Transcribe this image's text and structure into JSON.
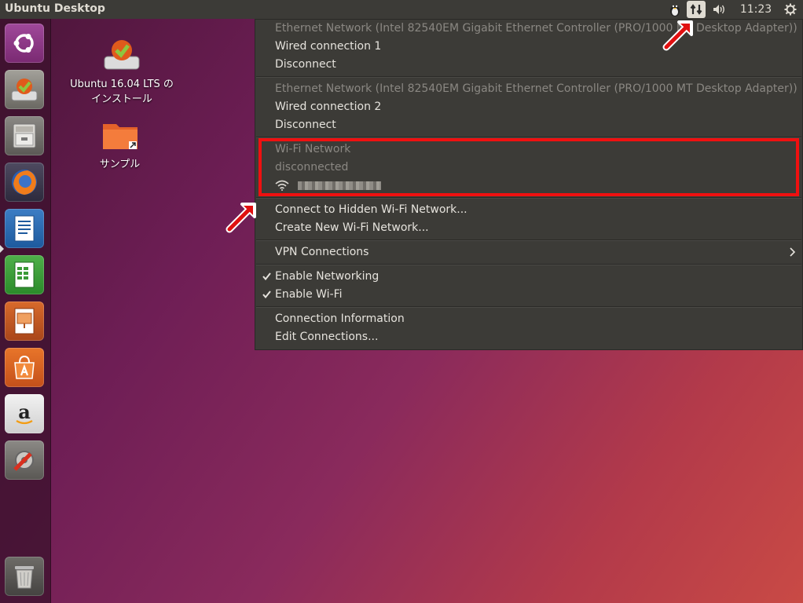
{
  "topbar": {
    "title": "Ubuntu Desktop",
    "clock": "11:23"
  },
  "launcher": {
    "items": [
      {
        "name": "ubuntu-dash-icon"
      },
      {
        "name": "ubuntu-installer-icon"
      },
      {
        "name": "files-icon"
      },
      {
        "name": "firefox-icon"
      },
      {
        "name": "libreoffice-writer-icon"
      },
      {
        "name": "libreoffice-calc-icon"
      },
      {
        "name": "libreoffice-impress-icon"
      },
      {
        "name": "software-center-icon"
      },
      {
        "name": "amazon-icon"
      },
      {
        "name": "system-settings-icon"
      },
      {
        "name": "trash-icon"
      }
    ]
  },
  "desktop": {
    "installer_label_line1": "Ubuntu 16.04 LTS の",
    "installer_label_line2": "インストール",
    "folder_label": "サンプル"
  },
  "menu": {
    "eth1_header": "Ethernet Network (Intel 82540EM Gigabit Ethernet Controller (PRO/1000 MT Desktop Adapter))",
    "eth1_conn": "Wired connection 1",
    "eth1_disconnect": "Disconnect",
    "eth2_header": "Ethernet Network (Intel 82540EM Gigabit Ethernet Controller (PRO/1000 MT Desktop Adapter))",
    "eth2_conn": "Wired connection 2",
    "eth2_disconnect": "Disconnect",
    "wifi_header": "Wi-Fi Network",
    "wifi_status": "disconnected",
    "hidden_wifi": "Connect to Hidden Wi-Fi Network...",
    "new_wifi": "Create New Wi-Fi Network...",
    "vpn": "VPN Connections",
    "enable_networking": "Enable Networking",
    "enable_wifi": "Enable Wi-Fi",
    "conn_info": "Connection Information",
    "edit_conn": "Edit Connections..."
  }
}
